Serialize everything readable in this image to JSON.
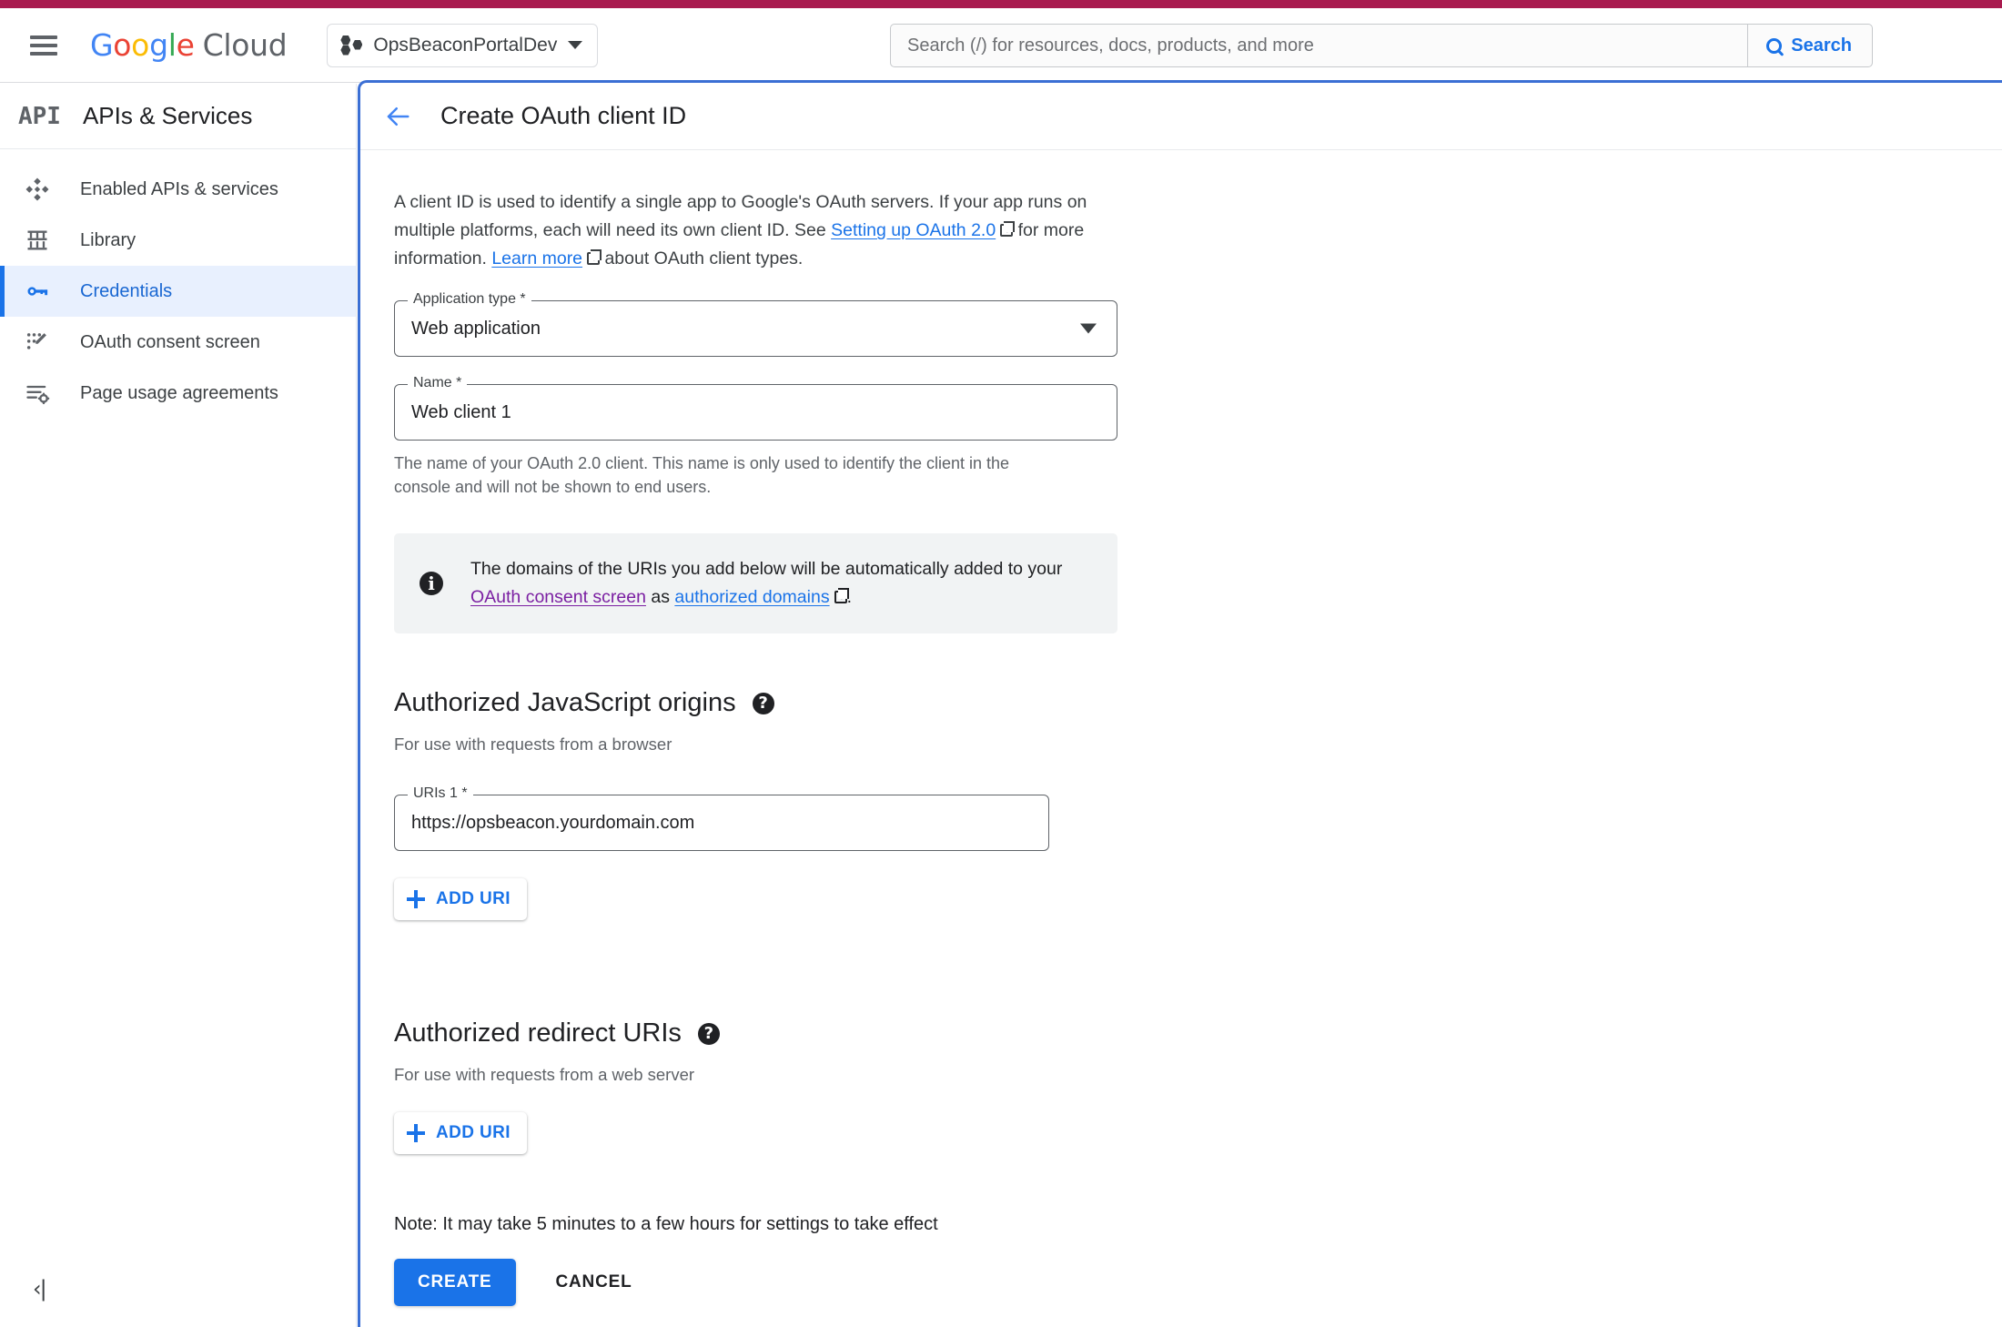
{
  "topbar": {
    "menu_icon": "hamburger-menu-icon",
    "logo_google": "Google",
    "logo_cloud": "Cloud",
    "project": {
      "name": "OpsBeaconPortalDev",
      "icon": "project-dots-icon",
      "caret": "chevron-down-icon"
    },
    "search": {
      "placeholder": "Search (/) for resources, docs, products, and more",
      "value": "",
      "button_label": "Search",
      "icon": "search-icon"
    },
    "accent_strip_color": "#A91B4F"
  },
  "sidebar": {
    "logo_text": "API",
    "title": "APIs & Services",
    "items": [
      {
        "label": "Enabled APIs & services",
        "icon": "dashboard-diamond-icon",
        "active": false
      },
      {
        "label": "Library",
        "icon": "library-icon",
        "active": false
      },
      {
        "label": "Credentials",
        "icon": "key-icon",
        "active": true
      },
      {
        "label": "OAuth consent screen",
        "icon": "consent-screen-icon",
        "active": false
      },
      {
        "label": "Page usage agreements",
        "icon": "agreements-icon",
        "active": false
      }
    ],
    "collapse_label": "‹|",
    "active_color": "#1967d2",
    "active_bg": "#e8f0fe"
  },
  "panel": {
    "back_icon": "back-arrow-icon",
    "title": "Create OAuth client ID",
    "border_color": "#3b6fd4",
    "intro": {
      "part1": "A client ID is used to identify a single app to Google's OAuth servers. If your app runs on multiple platforms, each will need its own client ID. See ",
      "link1": "Setting up OAuth 2.0",
      "part2": " for more information. ",
      "link2": "Learn more",
      "part3": " about OAuth client types."
    },
    "application_type": {
      "label": "Application type *",
      "value": "Web application",
      "caret": "chevron-down-icon"
    },
    "name": {
      "label": "Name *",
      "value": "Web client 1",
      "helper": "The name of your OAuth 2.0 client. This name is only used to identify the client in the console and will not be shown to end users."
    },
    "banner": {
      "icon": "info-icon",
      "part1": "The domains of the URIs you add below will be automatically added to your ",
      "link1": "OAuth consent screen",
      "link1_color": "#7B1FA2",
      "part2": " as ",
      "link2": "authorized domains",
      "part3": "."
    },
    "js_origins": {
      "title": "Authorized JavaScript origins",
      "help_icon": "help-icon",
      "subtitle": "For use with requests from a browser",
      "uri_label": "URIs 1 *",
      "uri_value": "https://opsbeacon.yourdomain.com",
      "add_label": "ADD URI",
      "add_icon": "plus-icon"
    },
    "redirect_uris": {
      "title": "Authorized redirect URIs",
      "help_icon": "help-icon",
      "subtitle": "For use with requests from a web server",
      "add_label": "ADD URI",
      "add_icon": "plus-icon"
    },
    "note": "Note: It may take 5 minutes to a few hours for settings to take effect",
    "create_label": "CREATE",
    "cancel_label": "CANCEL",
    "primary_color": "#1a73e8"
  }
}
